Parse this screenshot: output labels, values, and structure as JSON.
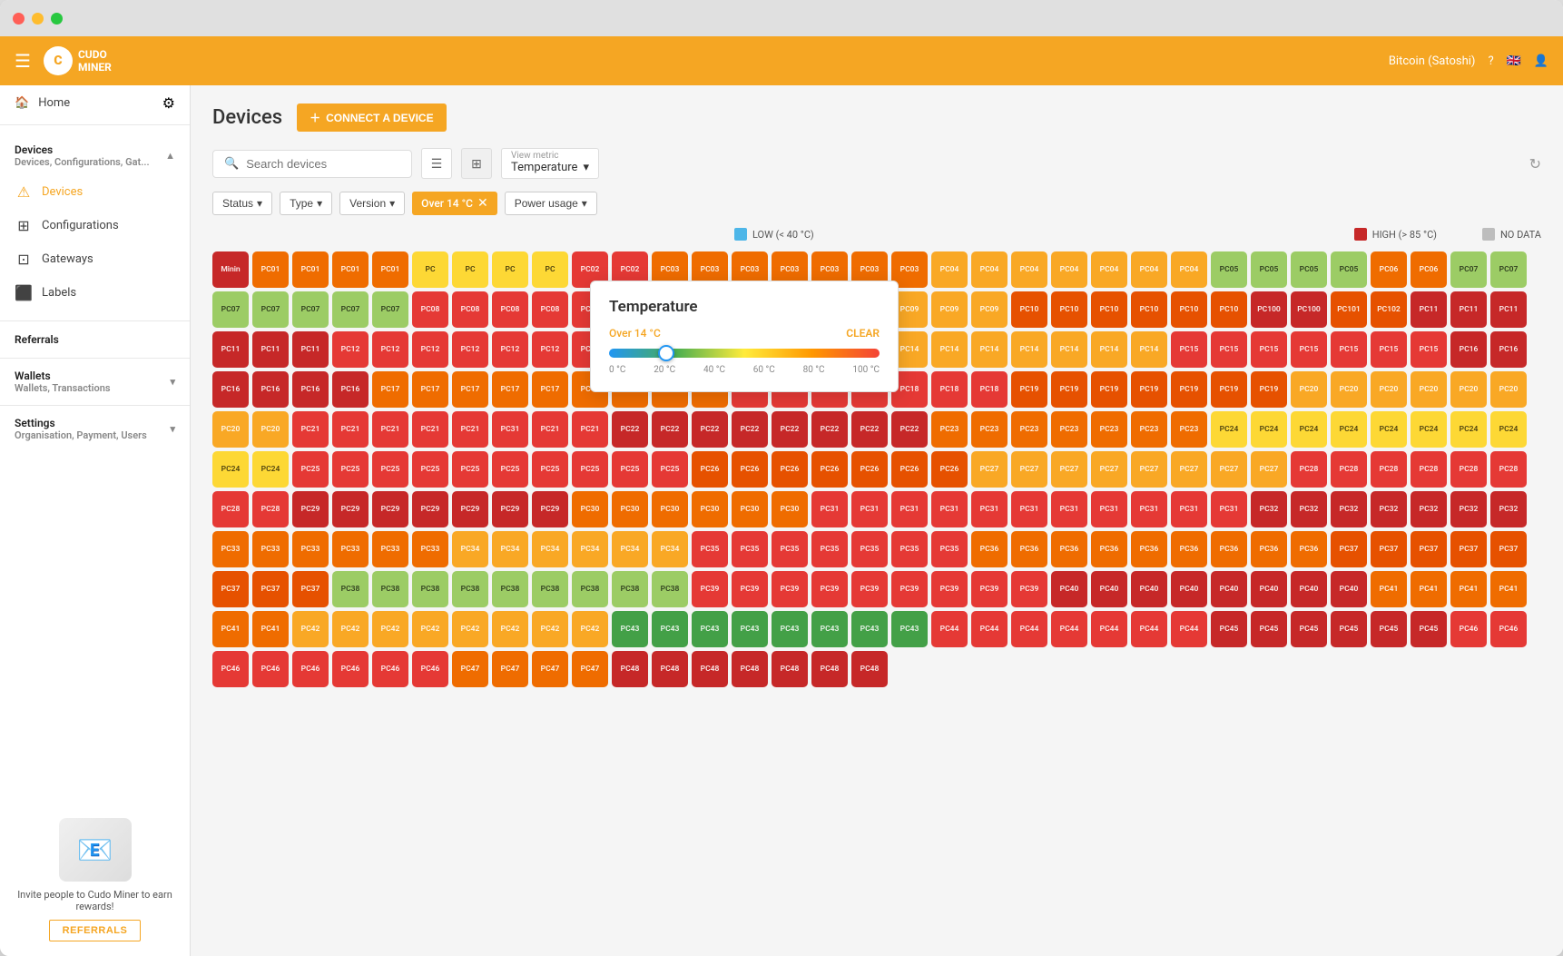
{
  "window": {
    "title": "Cudo Miner"
  },
  "topnav": {
    "logo_text": "CUDO\nMINER",
    "currency": "Bitcoin (Satoshi)"
  },
  "sidebar": {
    "home_label": "Home",
    "devices_group": "Devices",
    "devices_sub": "Devices, Configurations, Gat...",
    "items": [
      {
        "label": "Devices",
        "icon": "⚠",
        "active": true
      },
      {
        "label": "Configurations",
        "icon": "⊞",
        "active": false
      },
      {
        "label": "Gateways",
        "icon": "⊡",
        "active": false
      },
      {
        "label": "Labels",
        "icon": "⬛",
        "active": false
      }
    ],
    "referrals_label": "Referrals",
    "wallets_label": "Wallets",
    "wallets_sub": "Wallets, Transactions",
    "settings_label": "Settings",
    "settings_sub": "Organisation, Payment, Users",
    "referral_cta": "Invite people to Cudo Miner to earn rewards!",
    "referral_btn": "REFERRALS"
  },
  "page": {
    "title": "Devices",
    "connect_btn": "CONNECT A DEVICE"
  },
  "toolbar": {
    "search_placeholder": "Search devices",
    "view_metric_label": "View metric",
    "view_metric_value": "Temperature"
  },
  "filters": {
    "status": "Status",
    "type": "Type",
    "version": "Version",
    "active_filter": "Over 14 °C",
    "power_usage": "Power usage"
  },
  "legend": {
    "low_label": "LOW (< 40 °C)",
    "high_label": "HIGH (> 85 °C)",
    "no_data_label": "NO DATA",
    "low_color": "#4db6e8",
    "high_color": "#c62828",
    "no_data_color": "#bdbdbd"
  },
  "temperature_popup": {
    "title": "Temperature",
    "filter_label": "Over 14 °C",
    "clear_label": "CLEAR",
    "slider_min": "0 °C",
    "labels": [
      "0 °C",
      "20 °C",
      "40 °C",
      "60 °C",
      "80 °C",
      "100 °C"
    ]
  },
  "devices": {
    "colors": [
      "c-red",
      "c-dark-red",
      "c-orange",
      "c-dark-orange",
      "c-amber",
      "c-yellow",
      "c-yellow-green",
      "c-green",
      "c-teal",
      "c-gray"
    ],
    "rows": [
      [
        "Minin",
        "PC01",
        "PC01",
        "PC01",
        "PC01",
        "PC",
        "PC",
        "PC",
        "PC",
        "PC02",
        "PC02",
        "PC03",
        "PC03",
        "PC03",
        "PC03",
        "PC03",
        "PC03",
        "PC03",
        "PC04",
        "PC04",
        "PC04",
        "PC04",
        "PC04"
      ],
      [
        "PC04",
        "PC04",
        "PC05",
        "PC05",
        "PC05",
        "PC05",
        "PC06",
        "PC06",
        "PC07",
        "PC07",
        "PC07",
        "PC07",
        "PC07",
        "PC07",
        "PC07",
        "PC08",
        "PC08",
        "PC08",
        "PC08",
        "PC08",
        "PC08",
        "PC08"
      ],
      [
        "PC08",
        "PC09",
        "PC09",
        "PC09",
        "PC09",
        "PC09",
        "PC09",
        "PC09",
        "PC10",
        "PC10",
        "PC10",
        "PC10",
        "PC10",
        "PC10",
        "PC100",
        "PC100",
        "PC101",
        "PC102",
        "PC11",
        "PC11",
        "PC11",
        "PC11",
        "PC11",
        "PC11",
        "PC12"
      ],
      [
        "PC12",
        "PC12",
        "PC12",
        "PC12",
        "PC12",
        "PC12",
        "PC13",
        "PC13",
        "PC13",
        "PC13",
        "PC13",
        "PC13",
        "PC13",
        "PC14",
        "PC14",
        "PC14",
        "PC14",
        "PC14",
        "PC14",
        "PC14",
        "PC15",
        "PC15",
        "PC15",
        "PC15",
        "PC15",
        "PC15",
        "PC15",
        "PC16"
      ],
      [
        "PC16",
        "PC16",
        "PC16",
        "PC16",
        "PC16",
        "PC17",
        "PC17",
        "PC17",
        "PC17",
        "PC17",
        "PC17",
        "PC17",
        "PC17",
        "PC17",
        "PC18",
        "PC18",
        "PC18",
        "PC18",
        "PC18",
        "PC18",
        "PC18",
        "PC19",
        "PC19",
        "PC19",
        "PC19",
        "PC19"
      ],
      [
        "PC19",
        "PC19",
        "PC20",
        "PC20",
        "PC20",
        "PC20",
        "PC20",
        "PC20",
        "PC20",
        "PC20",
        "PC21",
        "PC21",
        "PC21",
        "PC21",
        "PC21",
        "PC31",
        "PC21",
        "PC21",
        "PC22",
        "PC22",
        "PC22",
        "PC22",
        "PC22",
        "PC22",
        "PC22",
        "PC22",
        "PC23",
        "PC23"
      ],
      [
        "PC23",
        "PC23",
        "PC23",
        "PC23",
        "PC23",
        "PC24",
        "PC24",
        "PC24",
        "PC24",
        "PC24",
        "PC24",
        "PC24",
        "PC24",
        "PC24",
        "PC24",
        "PC25",
        "PC25",
        "PC25",
        "PC25",
        "PC25",
        "PC25",
        "PC25",
        "PC25",
        "PC25",
        "PC25",
        "PC26",
        "PC26",
        "PC26",
        "PC26"
      ],
      [
        "PC26",
        "PC26",
        "PC26",
        "PC27",
        "PC27",
        "PC27",
        "PC27",
        "PC27",
        "PC27",
        "PC27",
        "PC27",
        "PC28",
        "PC28",
        "PC28",
        "PC28",
        "PC28",
        "PC28",
        "PC28",
        "PC28",
        "PC29",
        "PC29",
        "PC29",
        "PC29",
        "PC29",
        "PC29",
        "PC29",
        "PC30"
      ],
      [
        "PC30",
        "PC30",
        "PC30",
        "PC30",
        "PC30",
        "PC31",
        "PC31",
        "PC31",
        "PC31",
        "PC31",
        "PC31",
        "PC31",
        "PC31",
        "PC31",
        "PC31",
        "PC31",
        "PC32",
        "PC32",
        "PC32",
        "PC32",
        "PC32",
        "PC32",
        "PC32",
        "PC33",
        "PC33",
        "PC33",
        "PC33",
        "PC33",
        "PC33"
      ],
      [
        "PC34",
        "PC34",
        "PC34",
        "PC34",
        "PC34",
        "PC34",
        "PC35",
        "PC35",
        "PC35",
        "PC35",
        "PC35",
        "PC35",
        "PC35",
        "PC36",
        "PC36",
        "PC36",
        "PC36",
        "PC36",
        "PC36",
        "PC36",
        "PC36",
        "PC36",
        "PC37",
        "PC37",
        "PC37",
        "PC37",
        "PC37"
      ],
      [
        "PC37",
        "PC37",
        "PC37",
        "PC38",
        "PC38",
        "PC38",
        "PC38",
        "PC38",
        "PC38",
        "PC38",
        "PC38",
        "PC38",
        "PC39",
        "PC39",
        "PC39",
        "PC39",
        "PC39",
        "PC39",
        "PC39",
        "PC39",
        "PC39",
        "PC40",
        "PC40",
        "PC40",
        "PC40",
        "PC40",
        "PC40",
        "PC40",
        "PC40",
        "PC41"
      ],
      [
        "PC41",
        "PC41",
        "PC41",
        "PC41",
        "PC41",
        "PC42",
        "PC42",
        "PC42",
        "PC42",
        "PC42",
        "PC42",
        "PC42",
        "PC42",
        "PC43",
        "PC43",
        "PC43",
        "PC43",
        "PC43",
        "PC43",
        "PC43",
        "PC43",
        "PC44",
        "PC44",
        "PC44",
        "PC44",
        "PC44",
        "PC44",
        "PC44"
      ],
      [
        "PC45",
        "PC45",
        "PC45",
        "PC45",
        "PC45",
        "PC45",
        "PC46",
        "PC46",
        "PC46",
        "PC46",
        "PC46",
        "PC46",
        "PC46",
        "PC46",
        "PC47",
        "PC47",
        "PC47",
        "PC47",
        "PC48",
        "PC48",
        "PC48",
        "PC48",
        "PC48",
        "PC48",
        "PC48"
      ]
    ]
  }
}
